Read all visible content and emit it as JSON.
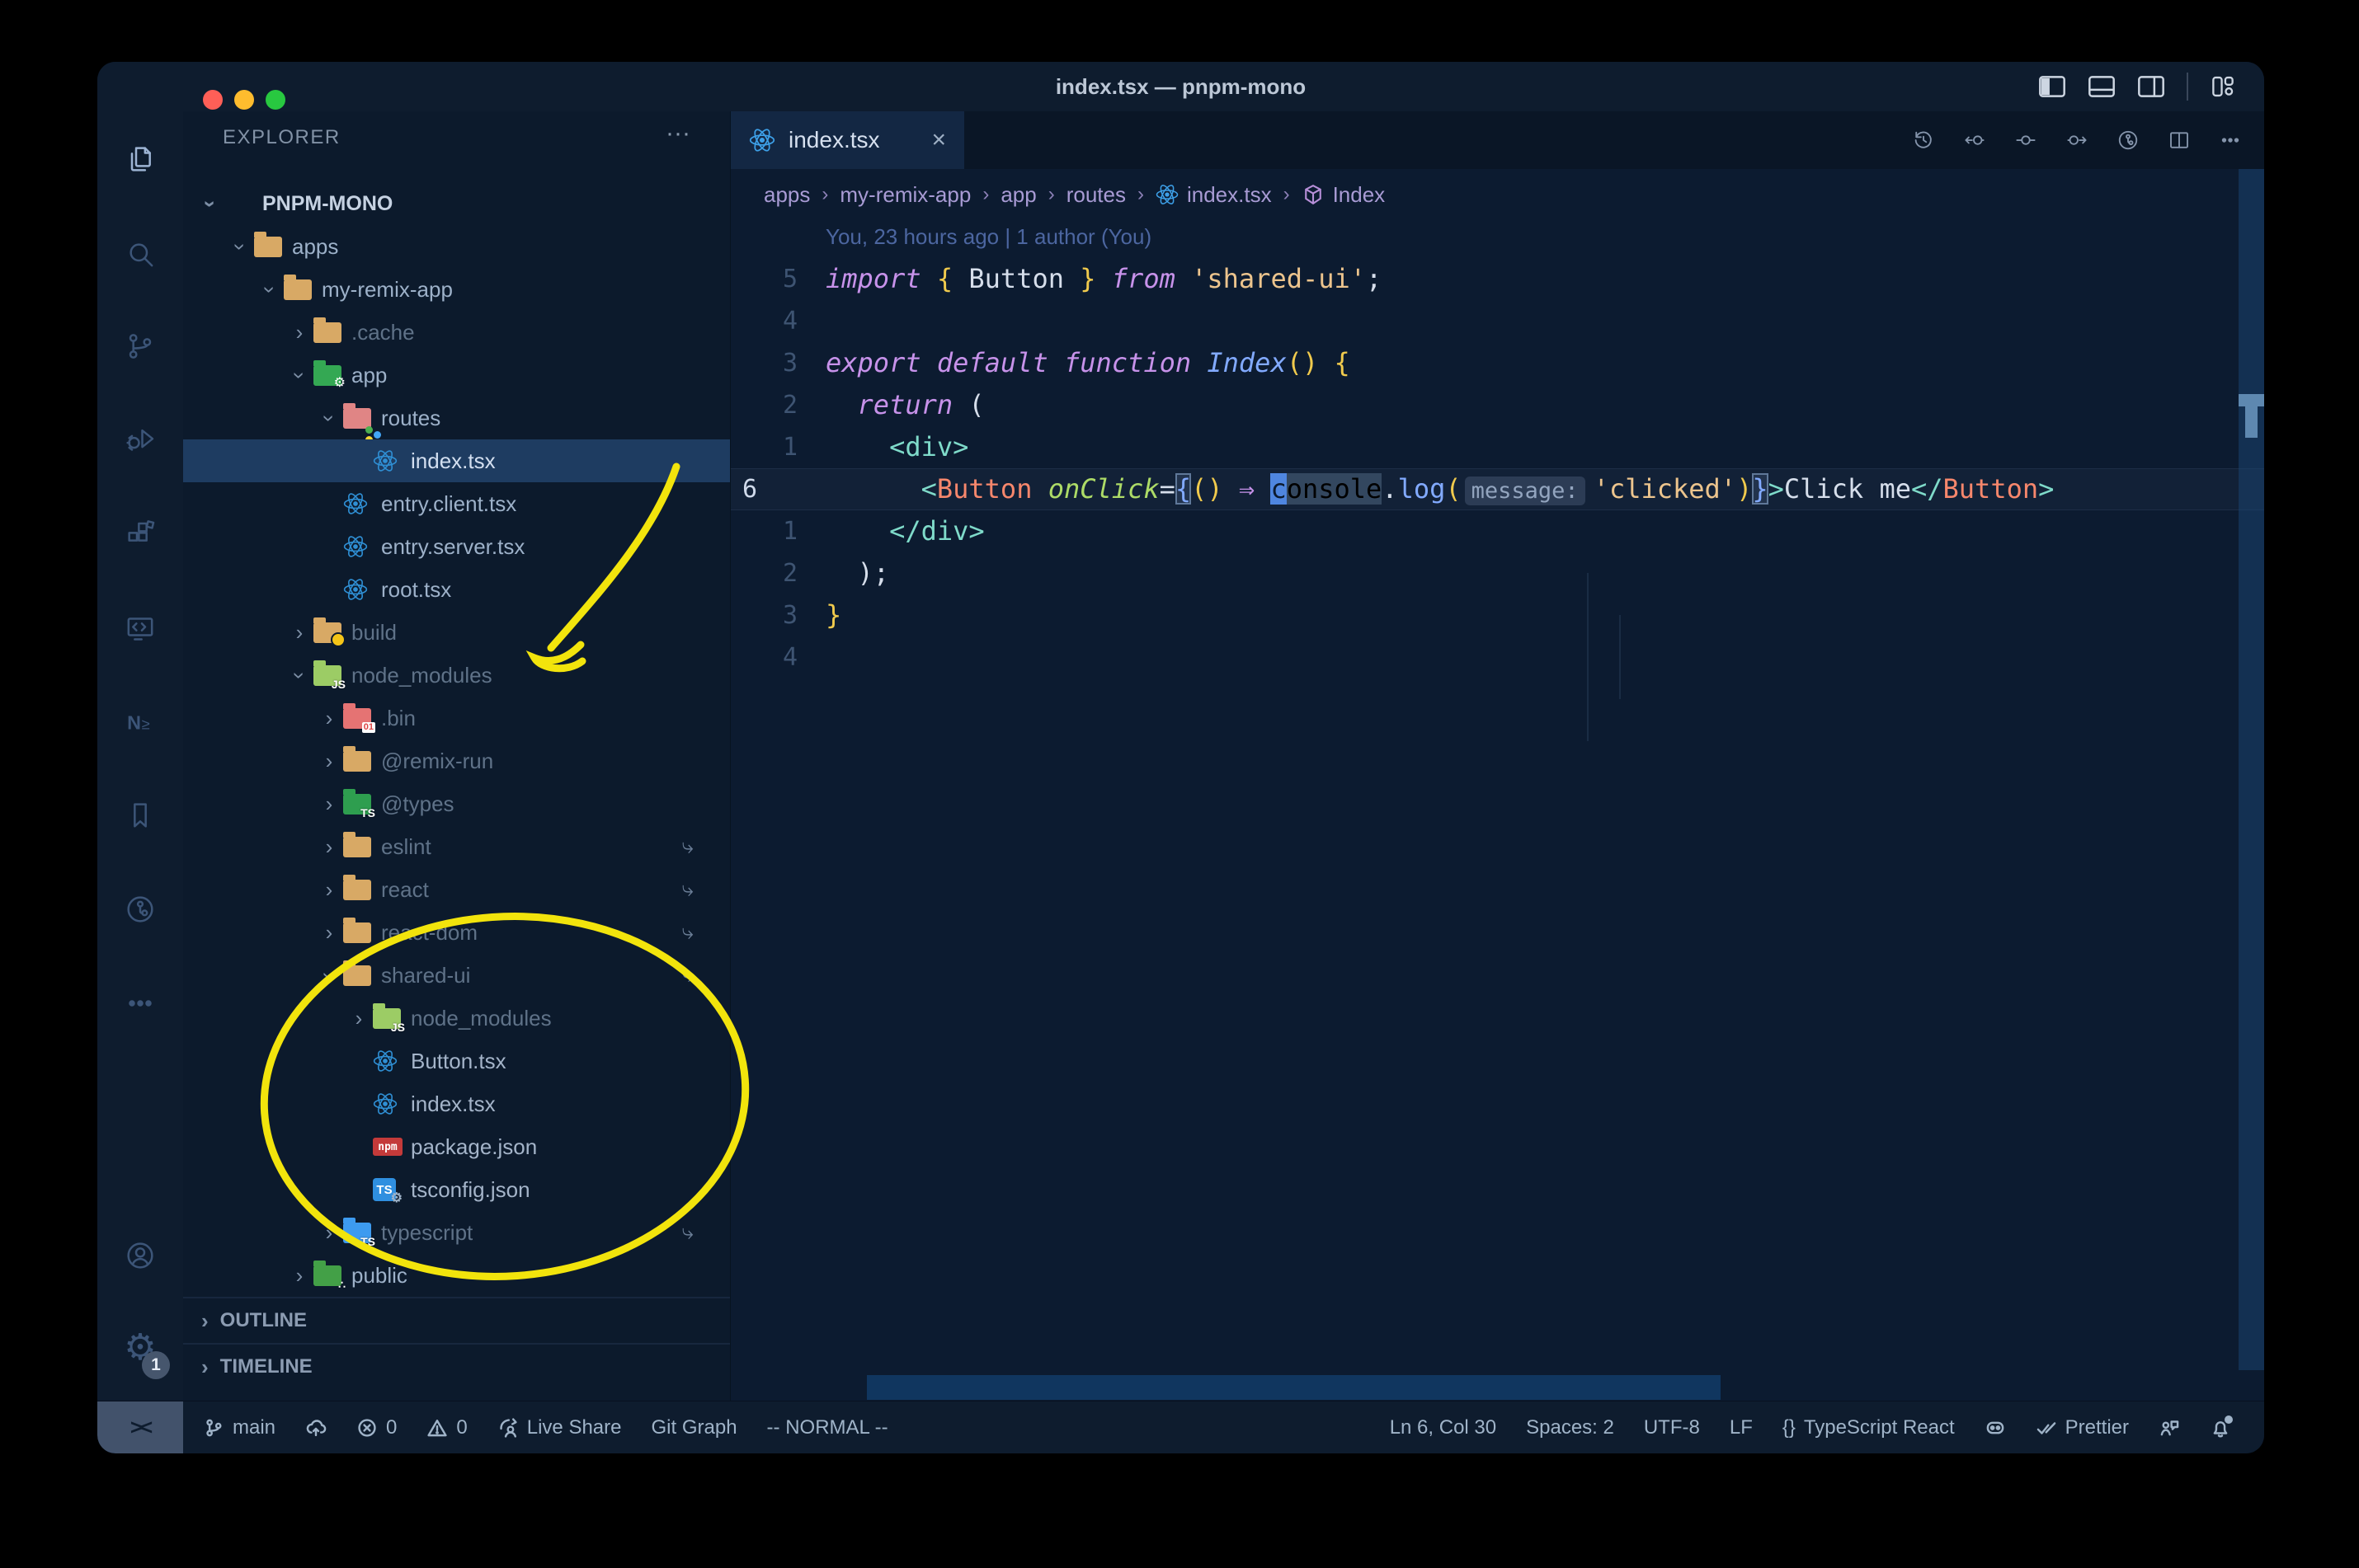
{
  "window": {
    "title": "index.tsx — pnpm-mono"
  },
  "title_bar": {
    "layout_icons": [
      "toggle-primary-sidebar",
      "toggle-panel",
      "toggle-secondary-sidebar",
      "customize-layout"
    ]
  },
  "activity_bar": {
    "top": [
      {
        "name": "explorer",
        "active": true
      },
      {
        "name": "search",
        "active": false
      },
      {
        "name": "source-control",
        "active": false
      },
      {
        "name": "run-and-debug",
        "active": false
      },
      {
        "name": "extensions",
        "active": false
      },
      {
        "name": "remote-explorer",
        "active": false
      },
      {
        "name": "nx-console",
        "active": false
      },
      {
        "name": "bookmarks",
        "active": false
      },
      {
        "name": "gitlens",
        "active": false
      },
      {
        "name": "more-views",
        "active": false
      }
    ],
    "bottom": [
      {
        "name": "accounts",
        "active": false
      },
      {
        "name": "settings",
        "active": false,
        "badge": "1"
      }
    ]
  },
  "sidebar": {
    "header": "EXPLORER",
    "header_more": "···",
    "tree": [
      {
        "label": "PNPM-MONO",
        "level": 0,
        "icon": "none",
        "chevron": "open",
        "style": "root"
      },
      {
        "label": "apps",
        "level": 1,
        "icon": "folder-tan",
        "chevron": "open",
        "style": ""
      },
      {
        "label": "my-remix-app",
        "level": 2,
        "icon": "folder-tan",
        "chevron": "open",
        "style": ""
      },
      {
        "label": ".cache",
        "level": 3,
        "icon": "folder-tan",
        "chevron": "closed",
        "style": "dim"
      },
      {
        "label": "app",
        "level": 3,
        "icon": "folder-app",
        "chevron": "open",
        "style": ""
      },
      {
        "label": "routes",
        "level": 4,
        "icon": "folder-routes",
        "chevron": "open",
        "style": ""
      },
      {
        "label": "index.tsx",
        "level": 5,
        "icon": "react",
        "chevron": "none",
        "style": "",
        "selected": true
      },
      {
        "label": "entry.client.tsx",
        "level": 4,
        "icon": "react",
        "chevron": "none",
        "style": ""
      },
      {
        "label": "entry.server.tsx",
        "level": 4,
        "icon": "react",
        "chevron": "none",
        "style": ""
      },
      {
        "label": "root.tsx",
        "level": 4,
        "icon": "react",
        "chevron": "none",
        "style": ""
      },
      {
        "label": "build",
        "level": 3,
        "icon": "folder-build",
        "chevron": "closed",
        "style": "dim"
      },
      {
        "label": "node_modules",
        "level": 3,
        "icon": "folder-nm",
        "chevron": "open",
        "style": "dim"
      },
      {
        "label": ".bin",
        "level": 4,
        "icon": "folder-bin",
        "chevron": "closed",
        "style": "dim"
      },
      {
        "label": "@remix-run",
        "level": 4,
        "icon": "folder-tan",
        "chevron": "closed",
        "style": "dim"
      },
      {
        "label": "@types",
        "level": 4,
        "icon": "folder-types",
        "chevron": "closed",
        "style": "dim"
      },
      {
        "label": "eslint",
        "level": 4,
        "icon": "folder-tan",
        "chevron": "closed",
        "style": "dim",
        "symlink": true
      },
      {
        "label": "react",
        "level": 4,
        "icon": "folder-tan",
        "chevron": "closed",
        "style": "dim",
        "symlink": true
      },
      {
        "label": "react-dom",
        "level": 4,
        "icon": "folder-tan",
        "chevron": "closed",
        "style": "dim",
        "symlink": true
      },
      {
        "label": "shared-ui",
        "level": 4,
        "icon": "folder-tan",
        "chevron": "open",
        "style": "dim",
        "symlink": true
      },
      {
        "label": "node_modules",
        "level": 5,
        "icon": "folder-nm",
        "chevron": "closed",
        "style": "dim"
      },
      {
        "label": "Button.tsx",
        "level": 5,
        "icon": "react",
        "chevron": "none",
        "style": "semi"
      },
      {
        "label": "index.tsx",
        "level": 5,
        "icon": "react",
        "chevron": "none",
        "style": "semi"
      },
      {
        "label": "package.json",
        "level": 5,
        "icon": "npm",
        "chevron": "none",
        "style": "semi"
      },
      {
        "label": "tsconfig.json",
        "level": 5,
        "icon": "tsconfig",
        "chevron": "none",
        "style": "semi"
      },
      {
        "label": "typescript",
        "level": 4,
        "icon": "folder-ts",
        "chevron": "closed",
        "style": "dim",
        "symlink": true
      },
      {
        "label": "public",
        "level": 3,
        "icon": "folder-public",
        "chevron": "closed",
        "style": ""
      }
    ],
    "sections": [
      {
        "label": "OUTLINE"
      },
      {
        "label": "TIMELINE"
      }
    ]
  },
  "editor": {
    "tab": {
      "label": "index.tsx",
      "icon": "react",
      "close": "×"
    },
    "actions": [
      "history",
      "previous-change",
      "changes",
      "next-change",
      "gitlens",
      "split-editor",
      "more-actions"
    ],
    "breadcrumbs": [
      {
        "label": "apps",
        "icon": ""
      },
      {
        "label": "my-remix-app",
        "icon": ""
      },
      {
        "label": "app",
        "icon": ""
      },
      {
        "label": "routes",
        "icon": ""
      },
      {
        "label": "index.tsx",
        "icon": "react"
      },
      {
        "label": "Index",
        "icon": "symbol-namespace"
      }
    ],
    "blame": "You, 23 hours ago | 1 author (You)",
    "lines": [
      {
        "num": "5",
        "cur": false,
        "tokens": [
          [
            "kwi",
            "import "
          ],
          [
            "brace",
            "{"
          ],
          [
            "plain",
            " Button "
          ],
          [
            "brace",
            "}"
          ],
          [
            "kwi",
            " from "
          ],
          [
            "str",
            "'shared-ui'"
          ],
          [
            "plain",
            ";"
          ]
        ]
      },
      {
        "num": "4",
        "cur": false,
        "tokens": []
      },
      {
        "num": "3",
        "cur": false,
        "tokens": [
          [
            "kwi",
            "export default function "
          ],
          [
            "fni",
            "Index"
          ],
          [
            "brace",
            "()"
          ],
          [
            "plain",
            " "
          ],
          [
            "brace",
            "{"
          ]
        ]
      },
      {
        "num": "2",
        "cur": false,
        "tokens": [
          [
            "plain",
            "  "
          ],
          [
            "kwi",
            "return"
          ],
          [
            "plain",
            " ("
          ]
        ]
      },
      {
        "num": "1",
        "cur": false,
        "tokens": [
          [
            "teal",
            "    <div>"
          ]
        ]
      },
      {
        "num": "6",
        "cur": true,
        "tokens": [
          [
            "plain",
            "      "
          ],
          [
            "teal",
            "<"
          ],
          [
            "comp",
            "Button"
          ],
          [
            "plain",
            " "
          ],
          [
            "attri",
            "onClick"
          ],
          [
            "plain",
            "="
          ],
          [
            "mbrace",
            "{"
          ],
          [
            "brace",
            "()"
          ],
          [
            "plain",
            " "
          ],
          [
            "arrow",
            "⇒"
          ],
          [
            "plain",
            " "
          ],
          [
            "cursor",
            "c"
          ],
          [
            "selw",
            "onsole"
          ],
          [
            "plain",
            "."
          ],
          [
            "fn",
            "log"
          ],
          [
            "brace",
            "("
          ],
          [
            "inlay",
            "message:"
          ],
          [
            "str",
            "'clicked'"
          ],
          [
            "brace",
            ")"
          ],
          [
            "mbrace",
            "}"
          ],
          [
            "teal",
            ">"
          ],
          [
            "plain",
            "Click me"
          ],
          [
            "teal",
            "</"
          ],
          [
            "comp",
            "Button"
          ],
          [
            "teal",
            ">"
          ]
        ]
      },
      {
        "num": "1",
        "cur": false,
        "tokens": [
          [
            "teal",
            "    </div>"
          ]
        ]
      },
      {
        "num": "2",
        "cur": false,
        "tokens": [
          [
            "plain",
            "  );"
          ]
        ]
      },
      {
        "num": "3",
        "cur": false,
        "tokens": [
          [
            "brace",
            "}"
          ]
        ]
      },
      {
        "num": "4",
        "cur": false,
        "tokens": []
      }
    ]
  },
  "status_bar": {
    "left": [
      {
        "name": "remote-indicator",
        "icon": "remote",
        "label": ""
      },
      {
        "name": "git-branch",
        "icon": "branch",
        "label": "main"
      },
      {
        "name": "sync",
        "icon": "cloud-upload",
        "label": ""
      },
      {
        "name": "errors",
        "icon": "error",
        "label": "0"
      },
      {
        "name": "warnings",
        "icon": "warning",
        "label": "0"
      },
      {
        "name": "live-share",
        "icon": "live-share",
        "label": "Live Share"
      },
      {
        "name": "git-graph",
        "icon": "",
        "label": "Git Graph"
      },
      {
        "name": "vim-mode",
        "icon": "",
        "label": "-- NORMAL --"
      }
    ],
    "right": [
      {
        "name": "cursor-position",
        "icon": "",
        "label": "Ln 6, Col 30"
      },
      {
        "name": "indentation",
        "icon": "",
        "label": "Spaces: 2"
      },
      {
        "name": "encoding",
        "icon": "",
        "label": "UTF-8"
      },
      {
        "name": "eol",
        "icon": "",
        "label": "LF"
      },
      {
        "name": "language-mode",
        "icon": "braces",
        "label": "TypeScript React"
      },
      {
        "name": "copilot",
        "icon": "copilot",
        "label": ""
      },
      {
        "name": "formatter-prettier",
        "icon": "double-check",
        "label": "Prettier"
      },
      {
        "name": "feedback",
        "icon": "feedback",
        "label": ""
      },
      {
        "name": "notifications",
        "icon": "bell-dot",
        "label": ""
      }
    ]
  },
  "annotations": {
    "color": "#f2e40c",
    "shapes": [
      "hand-drawn-arrow-to-node-modules",
      "hand-drawn-ellipse-around-shared-ui"
    ]
  }
}
